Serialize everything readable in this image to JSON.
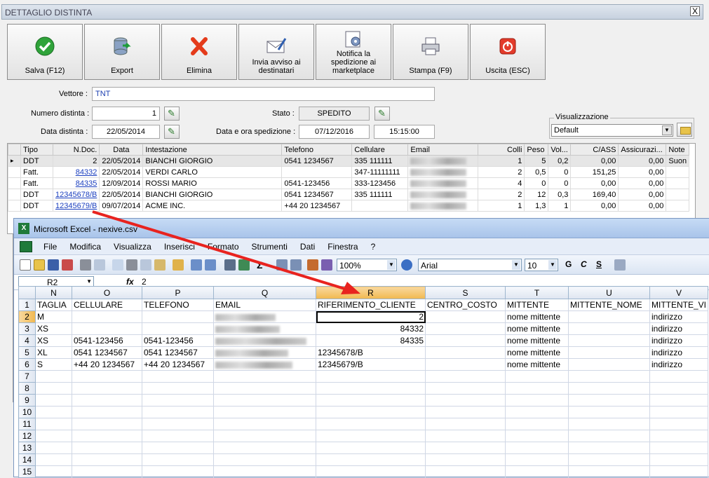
{
  "dialog": {
    "title": "DETTAGLIO DISTINTA",
    "close": "X",
    "toolbar": [
      {
        "label": "Salva (F12)",
        "icon": "check-icon"
      },
      {
        "label": "Export",
        "icon": "database-export-icon"
      },
      {
        "label": "Elimina",
        "icon": "delete-x-icon"
      },
      {
        "label": "Invia avviso ai destinatari",
        "icon": "mail-pen-icon"
      },
      {
        "label": "Notifica la spedizione ai marketplace",
        "icon": "notify-gear-icon"
      },
      {
        "label": "Stampa (F9)",
        "icon": "printer-icon"
      },
      {
        "label": "Uscita (ESC)",
        "icon": "exit-power-icon"
      }
    ],
    "fields": {
      "vettore_label": "Vettore :",
      "vettore_value": "TNT",
      "numero_label": "Numero distinta :",
      "numero_value": "1",
      "data_label": "Data distinta :",
      "data_value": "22/05/2014",
      "stato_label": "Stato :",
      "stato_value": "SPEDITO",
      "spedizione_label": "Data e ora spedizione :",
      "spedizione_date": "07/12/2016",
      "spedizione_time": "15:15:00",
      "visual_label": "Visualizzazione",
      "visual_value": "Default"
    },
    "grid": {
      "headers": [
        "Tipo",
        "N.Doc.",
        "Data",
        "Intestazione",
        "Telefono",
        "Cellulare",
        "Email",
        "Colli",
        "Peso",
        "Vol...",
        "C/ASS",
        "Assicurazi...",
        "Note"
      ],
      "rows": [
        [
          "DDT",
          "2",
          "22/05/2014",
          "BIANCHI GIORGIO",
          "0541 1234567",
          "335 111111",
          "",
          "1",
          "5",
          "0,2",
          "0,00",
          "0,00",
          "Suon"
        ],
        [
          "Fatt.",
          "84332",
          "22/05/2014",
          "VERDI CARLO",
          "",
          "347-11111111",
          "",
          "2",
          "0,5",
          "0",
          "151,25",
          "0,00",
          ""
        ],
        [
          "Fatt.",
          "84335",
          "12/09/2014",
          "ROSSI MARIO",
          "0541-123456",
          "333-123456",
          "",
          "4",
          "0",
          "0",
          "0,00",
          "0,00",
          ""
        ],
        [
          "DDT",
          "12345678/B",
          "22/05/2014",
          "BIANCHI GIORGIO",
          "0541 1234567",
          "335 111111",
          "",
          "2",
          "12",
          "0,3",
          "169,40",
          "0,00",
          ""
        ],
        [
          "DDT",
          "12345679/B",
          "09/07/2014",
          "ACME INC.",
          "+44 20 1234567",
          "",
          "",
          "1",
          "1,3",
          "1",
          "0,00",
          "0,00",
          ""
        ]
      ]
    }
  },
  "excel": {
    "title": "Microsoft Excel - nexive.csv",
    "menu": [
      "File",
      "Modifica",
      "Visualizza",
      "Inserisci",
      "Formato",
      "Strumenti",
      "Dati",
      "Finestra",
      "?"
    ],
    "zoom": "100%",
    "font": "Arial",
    "font_size": "10",
    "format_buttons": [
      "G",
      "C",
      "S"
    ],
    "cell_ref": "R2",
    "fx": "fx",
    "formula": "2",
    "col_headers": [
      "N",
      "O",
      "P",
      "Q",
      "R",
      "S",
      "T",
      "U",
      "V"
    ],
    "rows": [
      {
        "n": "1",
        "cells": [
          "TAGLIA",
          "CELLULARE",
          "TELEFONO",
          "EMAIL",
          "RIFERIMENTO_CLIENTE",
          "CENTRO_COSTO",
          "MITTENTE",
          "MITTENTE_NOME",
          "MITTENTE_VI"
        ]
      },
      {
        "n": "2",
        "cells": [
          "M",
          "",
          "",
          "",
          "2",
          "",
          "nome mittente",
          "",
          "indirizzo"
        ]
      },
      {
        "n": "3",
        "cells": [
          "XS",
          "",
          "",
          "",
          "84332",
          "",
          "nome mittente",
          "",
          "indirizzo"
        ]
      },
      {
        "n": "4",
        "cells": [
          "XS",
          "0541-123456",
          "0541-123456",
          "",
          "84335",
          "",
          "nome mittente",
          "",
          "indirizzo"
        ]
      },
      {
        "n": "5",
        "cells": [
          "XL",
          "0541 1234567",
          "0541 1234567",
          "",
          "12345678/B",
          "",
          "nome mittente",
          "",
          "indirizzo"
        ]
      },
      {
        "n": "6",
        "cells": [
          "S",
          "+44 20 1234567",
          "+44 20 1234567",
          "",
          "12345679/B",
          "",
          "nome mittente",
          "",
          "indirizzo"
        ]
      },
      {
        "n": "7",
        "cells": [
          "",
          "",
          "",
          "",
          "",
          "",
          "",
          "",
          ""
        ]
      },
      {
        "n": "8",
        "cells": [
          "",
          "",
          "",
          "",
          "",
          "",
          "",
          "",
          ""
        ]
      },
      {
        "n": "9",
        "cells": [
          "",
          "",
          "",
          "",
          "",
          "",
          "",
          "",
          ""
        ]
      },
      {
        "n": "10",
        "cells": [
          "",
          "",
          "",
          "",
          "",
          "",
          "",
          "",
          ""
        ]
      },
      {
        "n": "11",
        "cells": [
          "",
          "",
          "",
          "",
          "",
          "",
          "",
          "",
          ""
        ]
      },
      {
        "n": "12",
        "cells": [
          "",
          "",
          "",
          "",
          "",
          "",
          "",
          "",
          ""
        ]
      },
      {
        "n": "13",
        "cells": [
          "",
          "",
          "",
          "",
          "",
          "",
          "",
          "",
          ""
        ]
      },
      {
        "n": "14",
        "cells": [
          "",
          "",
          "",
          "",
          "",
          "",
          "",
          "",
          ""
        ]
      },
      {
        "n": "15",
        "cells": [
          "",
          "",
          "",
          "",
          "",
          "",
          "",
          "",
          ""
        ]
      }
    ]
  },
  "colors": {
    "arrow": "#e8231f",
    "link": "#1b3fbf"
  }
}
